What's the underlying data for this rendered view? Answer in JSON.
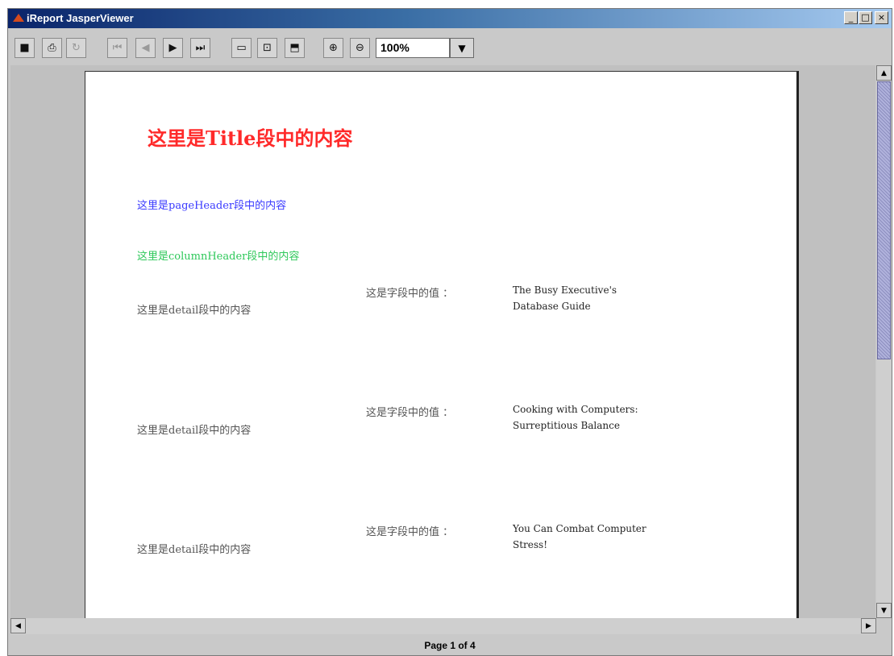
{
  "window": {
    "title": "iReport JasperViewer",
    "buttons": {
      "minimize": "_",
      "maximize": "□",
      "close": "×"
    }
  },
  "toolbar": {
    "save_icon": "■",
    "print_icon": "⎙",
    "reload_icon": "↻",
    "first_page_icon": "⏮",
    "previous_page_icon": "◀",
    "next_page_icon": "▶",
    "last_page_icon": "⏭",
    "actual_size_icon": "▭",
    "fit_page_icon": "⊡",
    "fit_width_icon": "⬒",
    "zoom_in_icon": "⊕",
    "zoom_out_icon": "⊖",
    "zoom_value": "100%",
    "zoom_dropdown_icon": "▼"
  },
  "report": {
    "title": "这里是Title段中的内容",
    "page_header": "这里是pageHeader段中的内容",
    "column_header": "这里是columnHeader段中的内容",
    "rows": [
      {
        "detail": "这里是detail段中的内容",
        "field_label": "这是字段中的值 ：",
        "value_line1": "The Busy Executive's",
        "value_line2": "Database Guide"
      },
      {
        "detail": "这里是detail段中的内容",
        "field_label": "这是字段中的值 ：",
        "value_line1": "Cooking with Computers:",
        "value_line2": "Surreptitious Balance"
      },
      {
        "detail": "这里是detail段中的内容",
        "field_label": "这是字段中的值 ：",
        "value_line1": "You Can Combat Computer",
        "value_line2": "Stress!"
      }
    ]
  },
  "scrollbar": {
    "up": "▲",
    "down": "▼",
    "left": "◀",
    "right": "▶"
  },
  "status": {
    "page_indicator": "Page 1 of 4"
  },
  "colors": {
    "title": "#ff2a2a",
    "page_header": "#3a3aff",
    "column_header": "#2ec85a",
    "detail_text": "#555555",
    "value_text": "#222222"
  }
}
